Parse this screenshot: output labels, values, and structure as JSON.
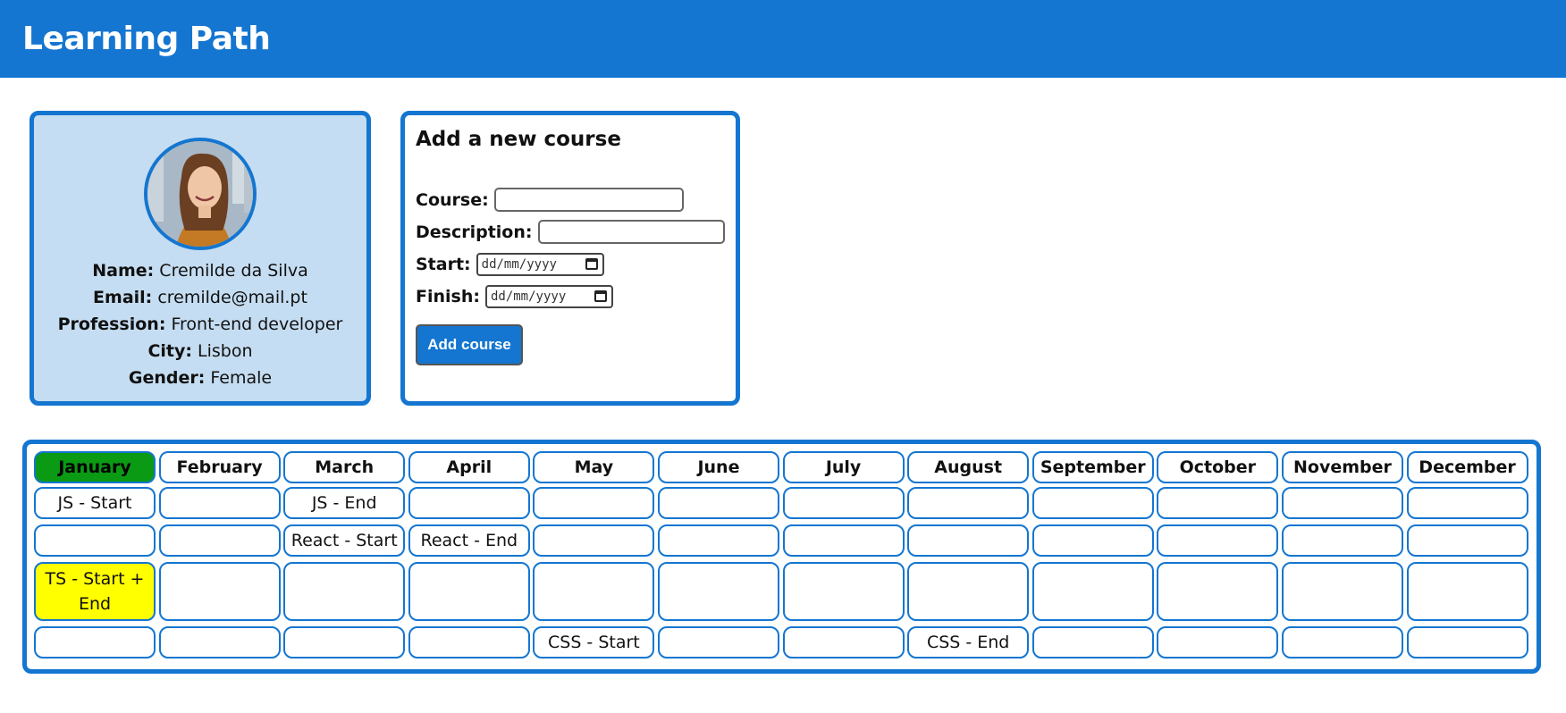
{
  "app": {
    "title": "Learning Path"
  },
  "profile": {
    "name_label": "Name:",
    "name": "Cremilde da Silva",
    "email_label": "Email:",
    "email": "cremilde@mail.pt",
    "profession_label": "Profession:",
    "profession": "Front-end developer",
    "city_label": "City:",
    "city": "Lisbon",
    "gender_label": "Gender:",
    "gender": "Female"
  },
  "form": {
    "title": "Add a new course",
    "course_label": "Course:",
    "description_label": "Description:",
    "start_label": "Start:",
    "finish_label": "Finish:",
    "date_placeholder": "dd/mm/yyyy",
    "submit_label": "Add course"
  },
  "calendar": {
    "months": [
      "January",
      "February",
      "March",
      "April",
      "May",
      "June",
      "July",
      "August",
      "September",
      "October",
      "November",
      "December"
    ],
    "active_month": "January",
    "colors": {
      "border": "#1476d0",
      "active_month": "#0a9a14",
      "highlight": "#ffff00"
    },
    "rows": [
      [
        "JS - Start",
        "",
        "JS - End",
        "",
        "",
        "",
        "",
        "",
        "",
        "",
        "",
        ""
      ],
      [
        "",
        "",
        "React - Start",
        "React - End",
        "",
        "",
        "",
        "",
        "",
        "",
        "",
        ""
      ],
      [
        "TS - Start + End",
        "",
        "",
        "",
        "",
        "",
        "",
        "",
        "",
        "",
        "",
        ""
      ],
      [
        "",
        "",
        "",
        "",
        "CSS - Start",
        "",
        "",
        "CSS - End",
        "",
        "",
        "",
        ""
      ]
    ]
  }
}
